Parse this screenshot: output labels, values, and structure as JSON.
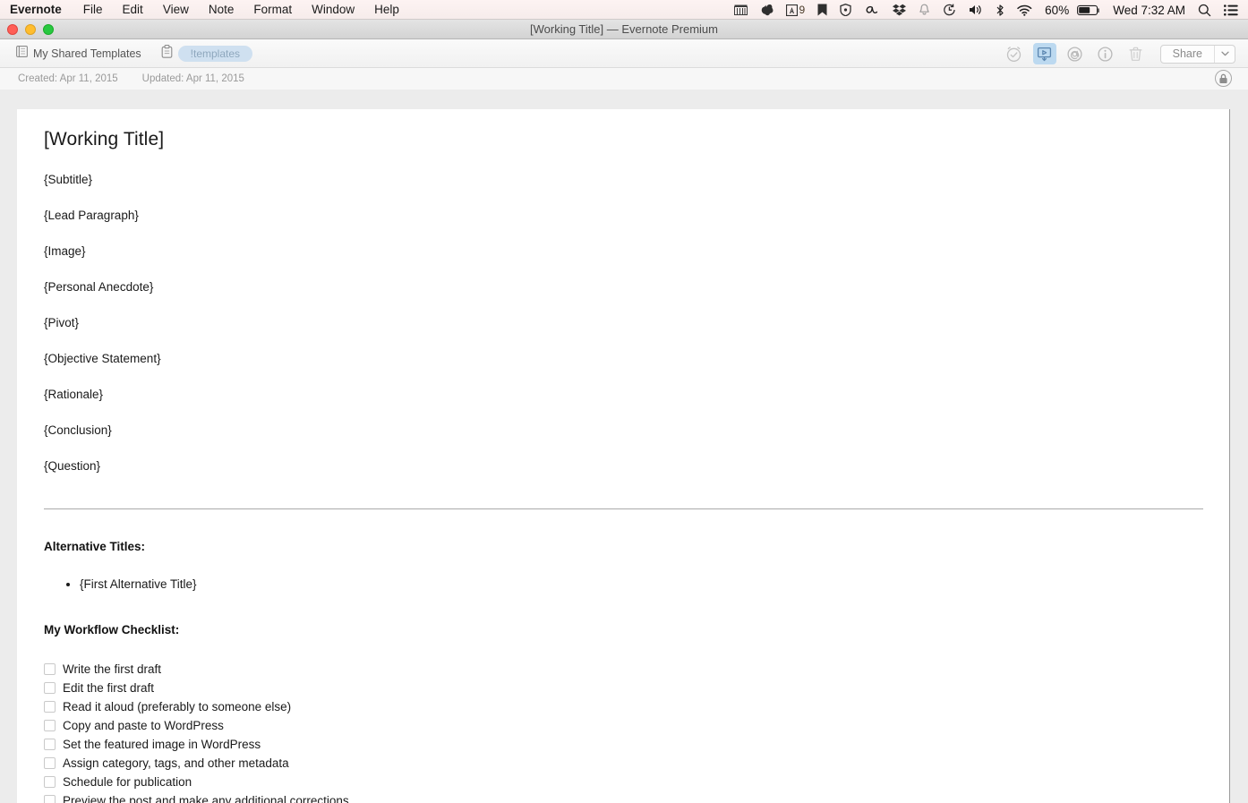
{
  "menubar": {
    "app_name": "Evernote",
    "menus": [
      "File",
      "Edit",
      "View",
      "Note",
      "Format",
      "Window",
      "Help"
    ],
    "status_icons": [
      {
        "name": "screen-capture-icon"
      },
      {
        "name": "evernote-elephant-icon"
      },
      {
        "name": "alfred-icon",
        "badge": "9"
      },
      {
        "name": "bookmark-icon"
      },
      {
        "name": "shield-icon"
      },
      {
        "name": "script-a-icon"
      },
      {
        "name": "dropbox-icon"
      },
      {
        "name": "bell-icon"
      },
      {
        "name": "time-machine-icon"
      },
      {
        "name": "volume-icon"
      },
      {
        "name": "bluetooth-icon"
      },
      {
        "name": "wifi-icon"
      }
    ],
    "battery_percent": "60%",
    "clock": "Wed 7:32 AM"
  },
  "window": {
    "title": "[Working Title] — Evernote Premium"
  },
  "toolbar": {
    "notebook": "My Shared Templates",
    "tag": "!templates",
    "share_label": "Share",
    "icons": [
      {
        "name": "reminder-icon"
      },
      {
        "name": "presentation-mode-icon"
      },
      {
        "name": "annotate-icon"
      },
      {
        "name": "info-icon"
      },
      {
        "name": "trash-icon"
      }
    ]
  },
  "meta": {
    "created": "Created: Apr 11, 2015",
    "updated": "Updated: Apr 11, 2015"
  },
  "note": {
    "title": "[Working Title]",
    "paragraphs": [
      "{Subtitle}",
      "{Lead Paragraph}",
      "{Image}",
      "{Personal Anecdote}",
      "{Pivot}",
      "{Objective Statement}",
      "{Rationale}",
      "{Conclusion}",
      "{Question}"
    ],
    "alt_titles_heading": "Alternative Titles:",
    "alt_titles": [
      "{First Alternative Title}"
    ],
    "checklist_heading": "My Workflow Checklist:",
    "checklist": [
      "Write the first draft",
      "Edit the first draft",
      "Read it aloud (preferably to someone else)",
      "Copy and paste to WordPress",
      "Set the featured image in WordPress",
      "Assign category, tags, and other metadata",
      "Schedule for publication",
      "Preview the post and make any additional corrections"
    ]
  },
  "colors": {
    "accent": "#bcd9f0",
    "tag_bg": "#cfe0f0",
    "menubar_bg": "#fdf3f2"
  }
}
